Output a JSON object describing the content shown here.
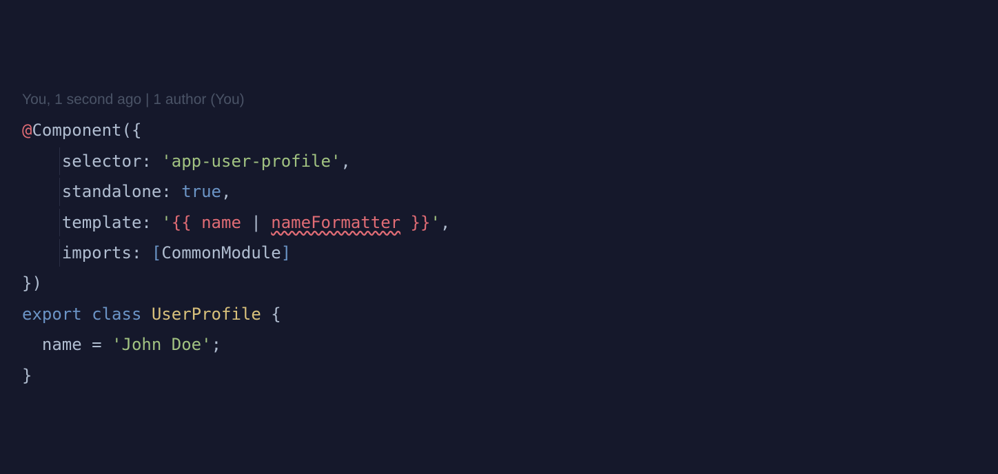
{
  "codelens": "You, 1 second ago | 1 author (You)",
  "line1": {
    "decorator": "@",
    "fn": "Component",
    "open": "({"
  },
  "line2": {
    "ws": "    ",
    "key": "selector",
    "colon": ": ",
    "q": "'",
    "val": "app-user-profile",
    "comma": ","
  },
  "line3": {
    "ws": "    ",
    "key": "standalone",
    "colon": ": ",
    "val": "true",
    "comma": ","
  },
  "line4": {
    "ws": "    ",
    "key": "template",
    "colon": ": ",
    "q": "'",
    "open": "{{ ",
    "name": "name",
    "pipe": " | ",
    "filter": "nameFormatter",
    "close": " }}",
    "comma": ","
  },
  "line5": {
    "ws": "    ",
    "key": "imports",
    "colon": ": ",
    "lb": "[",
    "val": "CommonModule",
    "rb": "]"
  },
  "line6": {
    "close": "})"
  },
  "line7": {
    "export": "export",
    "sp1": " ",
    "class": "class",
    "sp2": " ",
    "name": "UserProfile",
    "sp3": " ",
    "brace": "{"
  },
  "line8": {
    "ws": "  ",
    "field": "name",
    "eq": " = ",
    "q": "'",
    "val": "John Doe",
    "semi": ";"
  },
  "line9": {
    "brace": "}"
  }
}
